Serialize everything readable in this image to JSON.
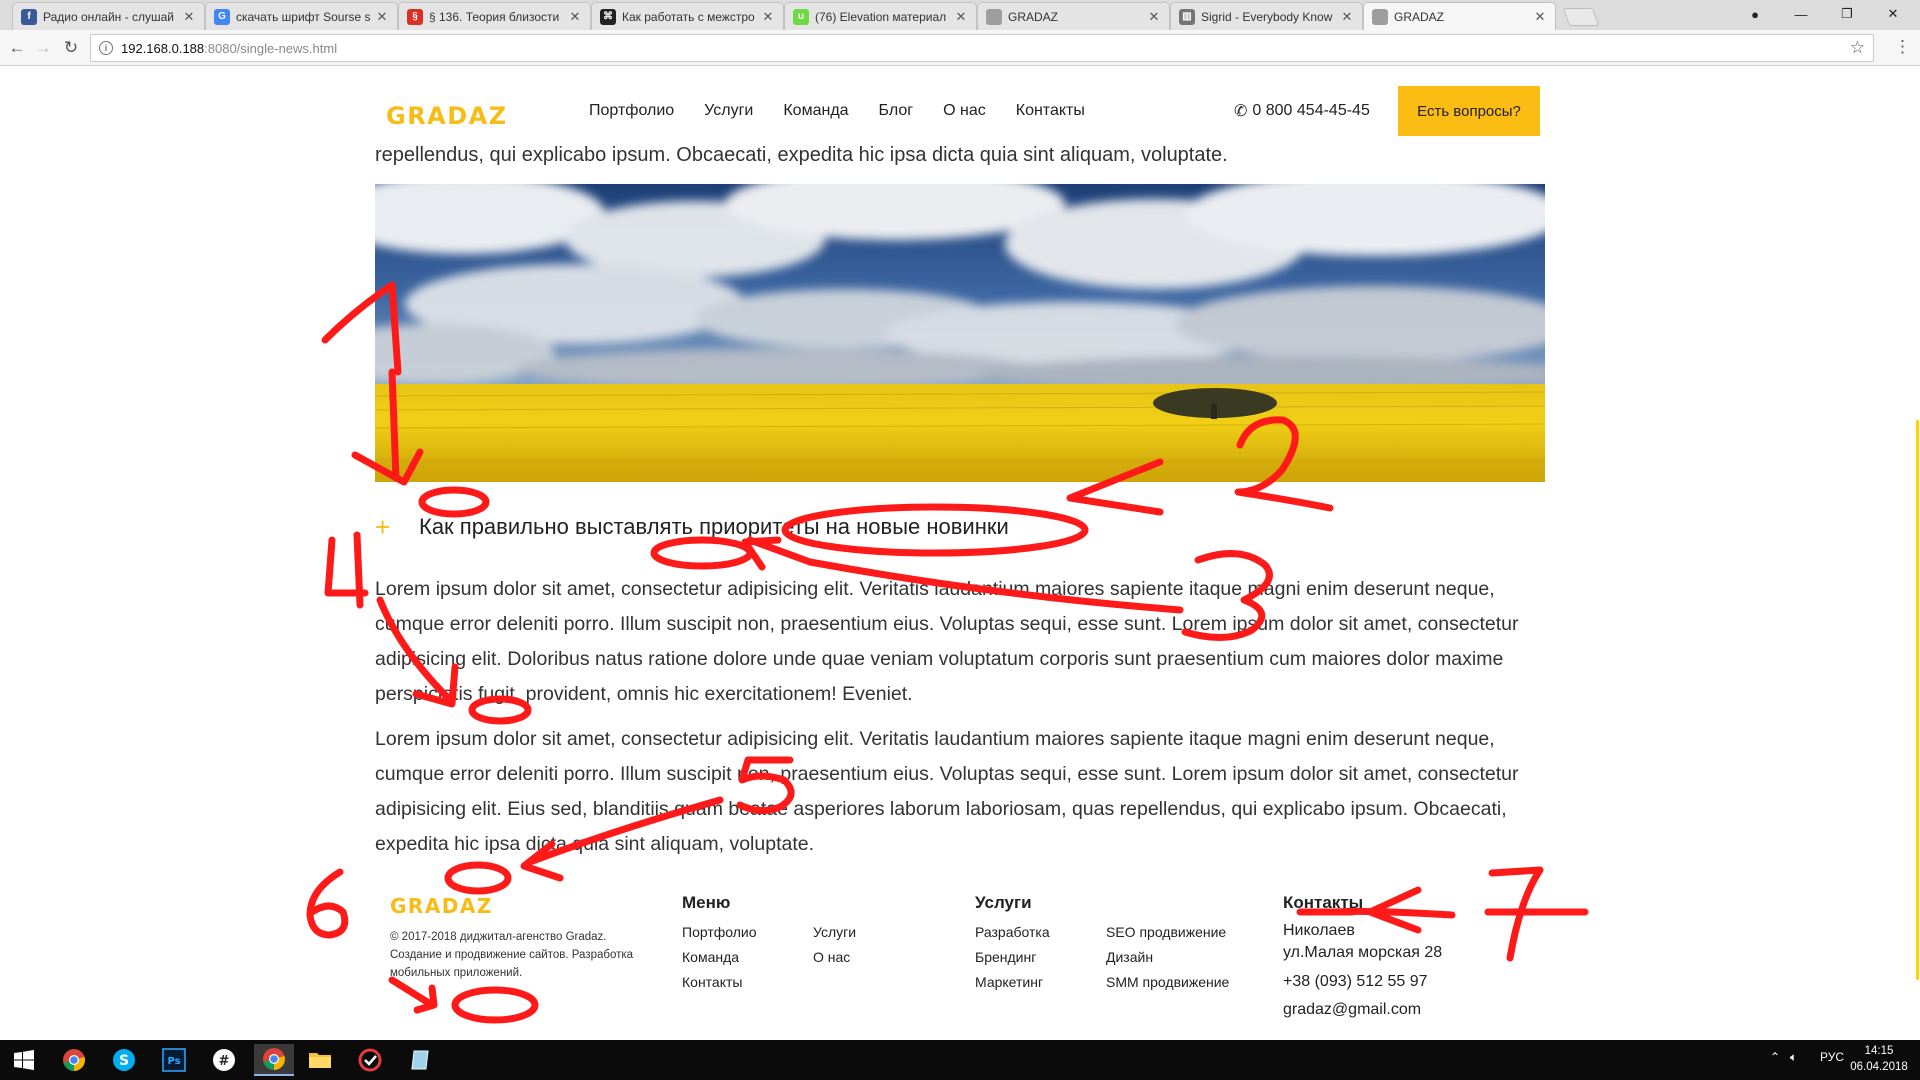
{
  "browser": {
    "tabs": [
      {
        "title": "Радио онлайн - слушай",
        "icon": "facebook-icon",
        "color": "#3b5998",
        "glyph": "f"
      },
      {
        "title": "скачать шрифт Sourse s",
        "icon": "google-icon",
        "color": "#4285f4",
        "glyph": "G"
      },
      {
        "title": "§ 136. Теория близости",
        "icon": "book-icon",
        "color": "#d93025",
        "glyph": "§"
      },
      {
        "title": "Как работать с межстро",
        "icon": "command-icon",
        "color": "#222222",
        "glyph": "⌘"
      },
      {
        "title": "(76) Elevation материал",
        "icon": "upwork-icon",
        "color": "#6fda44",
        "glyph": "u"
      },
      {
        "title": "GRADAZ",
        "icon": "page-icon",
        "color": "#9e9e9e",
        "glyph": ""
      },
      {
        "title": "Sigrid - Everybody Know",
        "icon": "chart-page-icon",
        "color": "#757575",
        "glyph": "▥"
      },
      {
        "title": "GRADAZ",
        "icon": "page-icon",
        "color": "#9e9e9e",
        "glyph": ""
      }
    ],
    "url_host": "192.168.0.188",
    "url_path": ":8080/single-news.html"
  },
  "site": {
    "logo": "GRADAZ",
    "nav": [
      "Портфолио",
      "Услуги",
      "Команда",
      "Блог",
      "О нас",
      "Контакты"
    ],
    "phone": "0 800 454-45-45",
    "cta": "Есть вопросы?"
  },
  "article": {
    "cut_line": "repellendus, qui explicabo ipsum. Obcaecati, expedita hic ipsa dicta quia sint aliquam, voluptate.",
    "title": "Как правильно выставлять приоритеты на новые новинки",
    "paragraphs": [
      "Lorem ipsum dolor sit amet, consectetur adipisicing elit. Veritatis laudantium maiores sapiente itaque magni enim deserunt neque, cumque error deleniti porro. Illum suscipit non, praesentium eius. Voluptas sequi, esse sunt. Lorem ipsum dolor sit amet, consectetur adipisicing elit. Doloribus natus ratione dolore unde quae veniam voluptatum corporis sunt praesentium cum maiores dolor maxime perspiciatis fugit, provident, omnis hic exercitationem! Eveniet.",
      "Lorem ipsum dolor sit amet, consectetur adipisicing elit. Veritatis laudantium maiores sapiente itaque magni enim deserunt neque, cumque error deleniti porro. Illum suscipit non, praesentium eius. Voluptas sequi, esse sunt. Lorem ipsum dolor sit amet, consectetur adipisicing elit. Eius sed, blanditiis quam beatae asperiores laborum laboriosam, quas repellendus, qui explicabo ipsum. Obcaecati, expedita hic ipsa dicta quia sint aliquam, voluptate."
    ]
  },
  "footer": {
    "logo": "GRADAZ",
    "copyright": "© 2017-2018 диджитал-агенство Gradaz. Создание и продвижение сайтов. Разработка мобильных приложений.",
    "menu_title": "Меню",
    "menu_col1": [
      "Портфолио",
      "Команда",
      "Контакты"
    ],
    "menu_col2": [
      "Услуги",
      "О нас"
    ],
    "services_title": "Услуги",
    "services_col1": [
      "Разработка",
      "Брендинг",
      "Маркетинг"
    ],
    "services_col2": [
      "SEO продвижение",
      "Дизайн",
      "SMM продвижение"
    ],
    "contacts_title": "Контакты",
    "city": "Николаев",
    "address": "ул.Малая морская 28",
    "phone": "+38 (093) 512 55 97",
    "email": "gradaz@gmail.com"
  },
  "annotations": {
    "color": "#ff1a1a",
    "numbers": [
      "1",
      "2",
      "3",
      "4",
      "5",
      "6",
      "7"
    ]
  },
  "taskbar": {
    "apps": [
      "windows-start-icon",
      "chrome-icon",
      "skype-icon",
      "photoshop-icon",
      "slack-icon",
      "chrome-icon",
      "file-explorer-icon",
      "wunderlist-icon",
      "notepad-icon"
    ],
    "lang": "РУС",
    "time": "14:15",
    "date": "06.04.2018"
  },
  "colors": {
    "brand_yellow": "#f8bc16",
    "cta_yellow": "#fbbd13"
  }
}
